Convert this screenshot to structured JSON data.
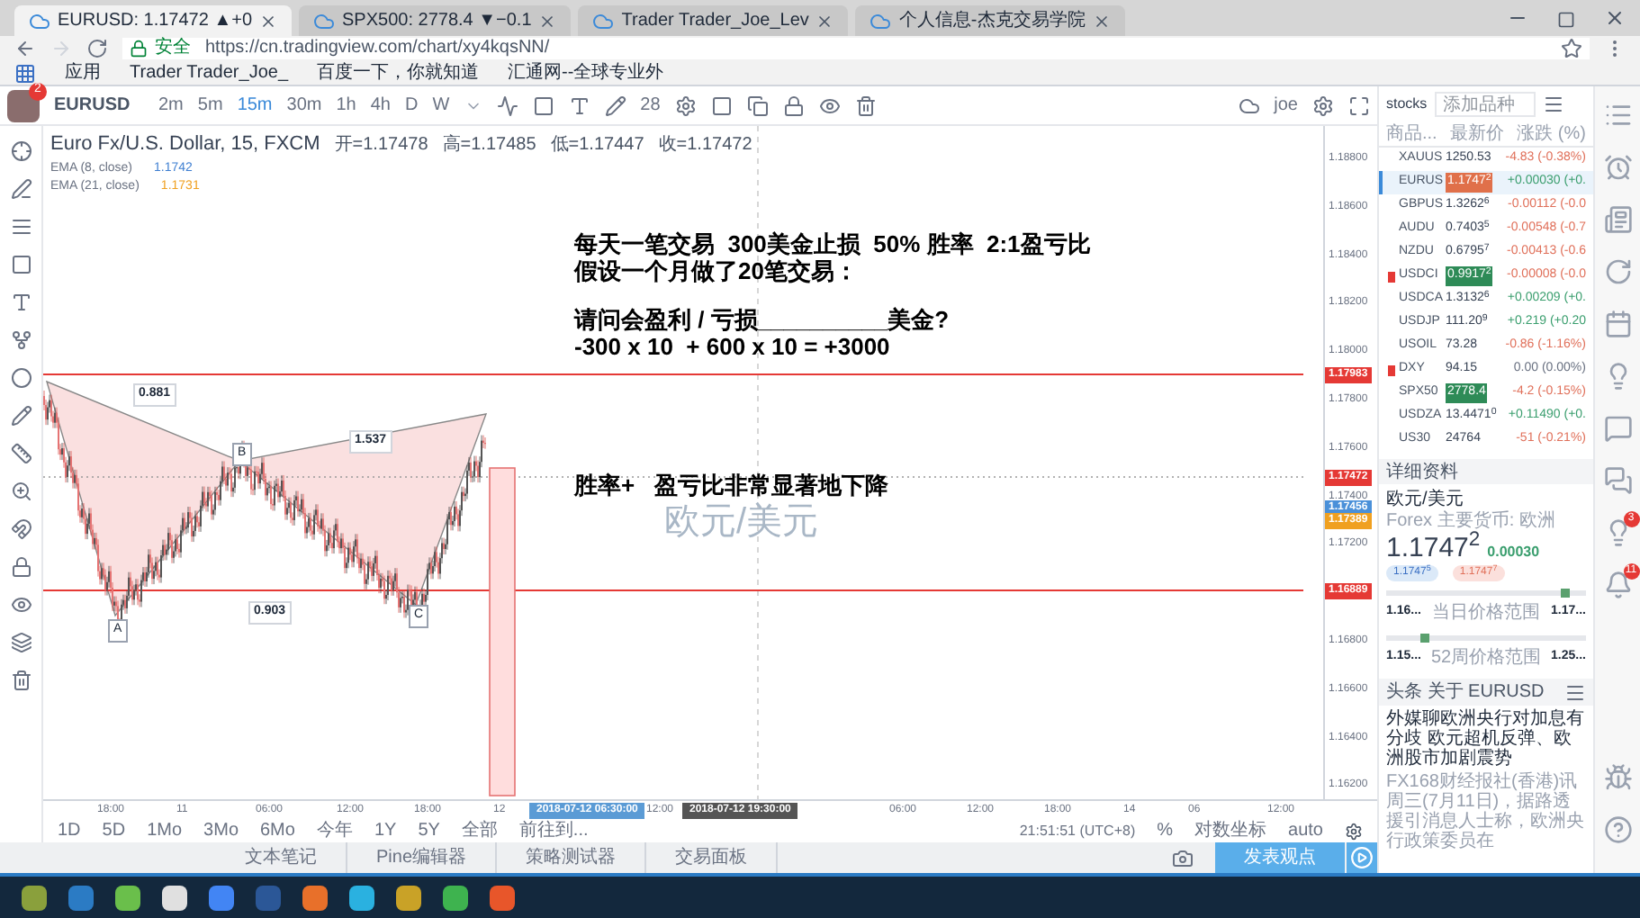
{
  "browser": {
    "tabs": [
      {
        "label": "EURUSD: 1.17472 ▲+0",
        "selected": true
      },
      {
        "label": "SPX500: 2778.4 ▼−0.1",
        "selected": false
      },
      {
        "label": "Trader Trader_Joe_Lev",
        "selected": false
      },
      {
        "label": "个人信息-杰克交易学院",
        "selected": false
      }
    ],
    "secure_label": "安全",
    "url": "https://cn.tradingview.com/chart/xy4kqsNN/",
    "bookmarks": [
      "应用",
      "Trader Trader_Joe_",
      "百度一下，你就知道",
      "汇通网--全球专业外"
    ]
  },
  "toolbar": {
    "avatar_badge": "2",
    "symbol": "EURUSD",
    "intervals": [
      {
        "label": "2m",
        "selected": false
      },
      {
        "label": "5m",
        "selected": false
      },
      {
        "label": "15m",
        "selected": true
      },
      {
        "label": "30m",
        "selected": false
      },
      {
        "label": "1h",
        "selected": false
      },
      {
        "label": "4h",
        "selected": false
      },
      {
        "label": "D",
        "selected": false
      },
      {
        "label": "W",
        "selected": false
      }
    ],
    "font_size": "28",
    "user": "joe"
  },
  "legend": {
    "title": "Euro Fx/U.S. Dollar, 15, FXCM",
    "values": [
      "开=1.17478",
      "高=1.17485",
      "低=1.17447",
      "收=1.17472"
    ],
    "indicators": [
      {
        "name": "EMA (8, close)",
        "value": "1.1742",
        "color": "#3f7fd1"
      },
      {
        "name": "EMA (21, close)",
        "value": "1.1731",
        "color": "#f0a020"
      }
    ]
  },
  "chart": {
    "watermark": "欧元/美元",
    "pattern_labels": [
      "0.881",
      "1.537",
      "0.903"
    ],
    "points": [
      "B",
      "A",
      "C"
    ],
    "notes": [
      "每天一笔交易  300美金止损  50% 胜率  2:1盈亏比",
      "假设一个月做了20笔交易：",
      "请问会盈利 / 亏损__________美金?",
      "-300 x 10  + 600 x 10 = +3000"
    ],
    "note_after": "胜率+   盈亏比非常显著地下降",
    "price_labels": [
      "1.18800",
      "1.18600",
      "1.18400",
      "1.18200",
      "1.18000",
      "1.17800",
      "1.17600",
      "1.17400",
      "1.17200",
      "1.16800",
      "1.16600",
      "1.16400",
      "1.16200"
    ],
    "price_tags": [
      {
        "label": "1.17983",
        "color": "#e53935"
      },
      {
        "label": "1.17472",
        "color": "#e53935"
      },
      {
        "label": "1.17456",
        "color": "#4a90d9"
      },
      {
        "label": "1.17389",
        "color": "#f0a020"
      },
      {
        "label": "1.16889",
        "color": "#e53935"
      }
    ],
    "time_labels": [
      {
        "label": "18:00",
        "kind": "plain"
      },
      {
        "label": "11",
        "kind": "plain"
      },
      {
        "label": "06:00",
        "kind": "plain"
      },
      {
        "label": "12:00",
        "kind": "plain"
      },
      {
        "label": "18:00",
        "kind": "plain"
      },
      {
        "label": "12",
        "kind": "plain"
      },
      {
        "label": "2018-07-12 06:30:00",
        "kind": "cursor"
      },
      {
        "label": "12:00",
        "kind": "plain"
      },
      {
        "label": "2018-07-12 19:30:00",
        "kind": "marker"
      },
      {
        "label": "06:00",
        "kind": "plain"
      },
      {
        "label": "12:00",
        "kind": "plain"
      },
      {
        "label": "18:00",
        "kind": "plain"
      },
      {
        "label": "14",
        "kind": "plain"
      },
      {
        "label": "06",
        "kind": "plain"
      },
      {
        "label": "12:00",
        "kind": "plain"
      }
    ]
  },
  "range_bar": {
    "ranges": [
      "1D",
      "5D",
      "1Mo",
      "3Mo",
      "6Mo",
      "今年",
      "1Y",
      "5Y",
      "全部"
    ],
    "goto": "前往到...",
    "clock": "21:51:51 (UTC+8)",
    "percent": "%",
    "log": "对数坐标",
    "auto": "auto"
  },
  "bottom_tabs": [
    "文本笔记",
    "Pine编辑器",
    "策略测试器",
    "交易面板"
  ],
  "publish_button": "发表观点",
  "watchlist": {
    "name": "stocks",
    "placeholder": "添加品种",
    "columns": [
      "商品...",
      "最新价",
      "涨跌 (%)"
    ],
    "rows": [
      {
        "symbol": "XAUUS",
        "price": "1250.53",
        "change": "-4.83 (-0.38%)",
        "kind": "down",
        "flagged": false,
        "selected": false
      },
      {
        "symbol": "EURUS",
        "price": "1.1747$^{2}$",
        "change": "+0.00030 (+0.",
        "kind": "up",
        "flagged": false,
        "selected": true,
        "color": "#e0704a"
      },
      {
        "symbol": "GBPUS",
        "price": "1.3262$^{6}$",
        "change": "-0.00112 (-0.0",
        "kind": "down",
        "flagged": false,
        "selected": false
      },
      {
        "symbol": "AUDU",
        "price": "0.7403$^{5}$",
        "change": "-0.00548 (-0.7",
        "kind": "down",
        "flagged": false,
        "selected": false
      },
      {
        "symbol": "NZDU",
        "price": "0.6795$^{7}$",
        "change": "-0.00413 (-0.6",
        "kind": "down",
        "flagged": false,
        "selected": false
      },
      {
        "symbol": "USDCI",
        "price": "0.9917$^{2}$",
        "change": "-0.00008 (-0.0",
        "kind": "down",
        "flagged": true,
        "selected": false,
        "color": "#2e8b57"
      },
      {
        "symbol": "USDCA",
        "price": "1.3132$^{6}$",
        "change": "+0.00209 (+0.",
        "kind": "up",
        "flagged": false,
        "selected": false
      },
      {
        "symbol": "USDJP",
        "price": "111.20$^{9}$",
        "change": "+0.219 (+0.20",
        "kind": "up",
        "flagged": false,
        "selected": false
      },
      {
        "symbol": "USOIL",
        "price": "73.28",
        "change": "-0.86 (-1.16%)",
        "kind": "down",
        "flagged": false,
        "selected": false
      },
      {
        "symbol": "DXY",
        "price": "94.15",
        "change": "0.00 (0.00%)",
        "kind": "flat",
        "flagged": true,
        "selected": false
      },
      {
        "symbol": "SPX50",
        "price": "2778.4",
        "change": "-4.2 (-0.15%)",
        "kind": "down",
        "flagged": false,
        "selected": false,
        "color": "#2e8b57"
      },
      {
        "symbol": "USDZA",
        "price": "13.4471$^{0}$",
        "change": "+0.11490 (+0.",
        "kind": "up",
        "flagged": false,
        "selected": false
      },
      {
        "symbol": "US30",
        "price": "24764",
        "change": "-51 (-0.21%)",
        "kind": "down",
        "flagged": false,
        "selected": false
      }
    ]
  },
  "details": {
    "heading": "详细资料",
    "pair": "欧元/美元",
    "market": "Forex 主要货币: 欧洲",
    "price": "1.1747$^{2}$",
    "change": "0.00030",
    "bid": "1.1747$^{5}$",
    "ask": "1.1747$^{7}$",
    "ranges": [
      {
        "low": "1.16...",
        "label": "当日价格范围",
        "high": "1.17...",
        "level": 0.9
      },
      {
        "low": "1.15...",
        "label": "52周价格范围",
        "high": "1.25...",
        "level": 0.2
      }
    ],
    "news_heading": "头条 关于 EURUSD",
    "headline": "外媒聊欧洲央行对加息有分歧 欧元超机反弹、欧洲股市加剧震势",
    "body": "FX168财经报社(香港)讯周三(7月11日)，据路透援引消息人士称，欧洲央行政策委员在"
  },
  "side_badges": [
    "3",
    "11"
  ]
}
